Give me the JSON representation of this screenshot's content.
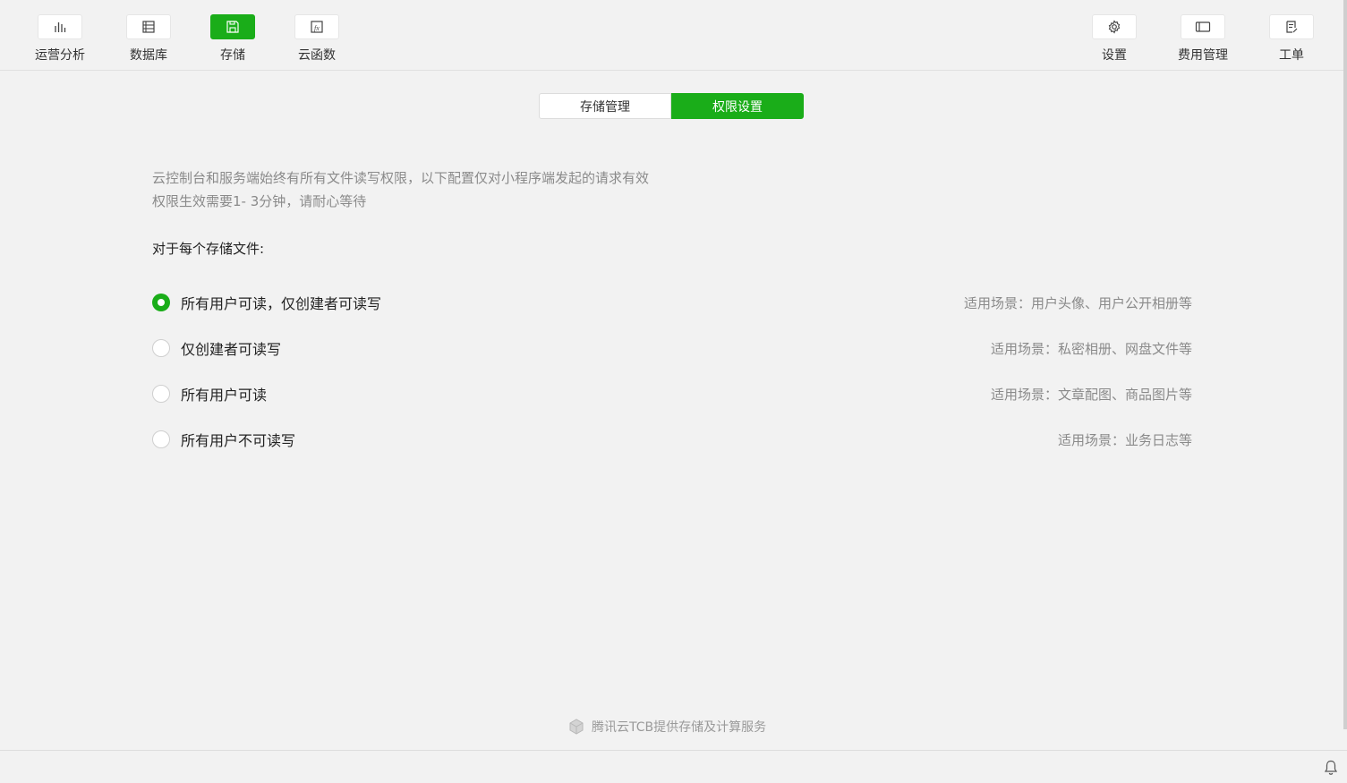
{
  "toolbar": {
    "left": [
      {
        "label": "运营分析",
        "icon": "bar-chart-icon"
      },
      {
        "label": "数据库",
        "icon": "database-icon"
      },
      {
        "label": "存储",
        "icon": "floppy-disk-icon",
        "active": true
      },
      {
        "label": "云函数",
        "icon": "function-icon"
      }
    ],
    "right": [
      {
        "label": "设置",
        "icon": "gear-icon"
      },
      {
        "label": "费用管理",
        "icon": "wallet-icon"
      },
      {
        "label": "工单",
        "icon": "ticket-icon"
      }
    ]
  },
  "tabs": [
    {
      "label": "存储管理",
      "active": false
    },
    {
      "label": "权限设置",
      "active": true
    }
  ],
  "description": {
    "line1": "云控制台和服务端始终有所有文件读写权限，以下配置仅对小程序端发起的请求有效",
    "line2": "权限生效需要1- 3分钟，请耐心等待"
  },
  "heading": "对于每个存储文件:",
  "options": [
    {
      "label": "所有用户可读，仅创建者可读写",
      "scene": "适用场景：用户头像、用户公开相册等",
      "checked": true
    },
    {
      "label": "仅创建者可读写",
      "scene": "适用场景：私密相册、网盘文件等",
      "checked": false
    },
    {
      "label": "所有用户可读",
      "scene": "适用场景：文章配图、商品图片等",
      "checked": false
    },
    {
      "label": "所有用户不可读写",
      "scene": "适用场景：业务日志等",
      "checked": false
    }
  ],
  "footer": {
    "text": "腾讯云TCB提供存储及计算服务"
  },
  "colors": {
    "accent": "#1aad19",
    "background": "#f2f2f2",
    "muted_text": "#8a8a8a"
  }
}
